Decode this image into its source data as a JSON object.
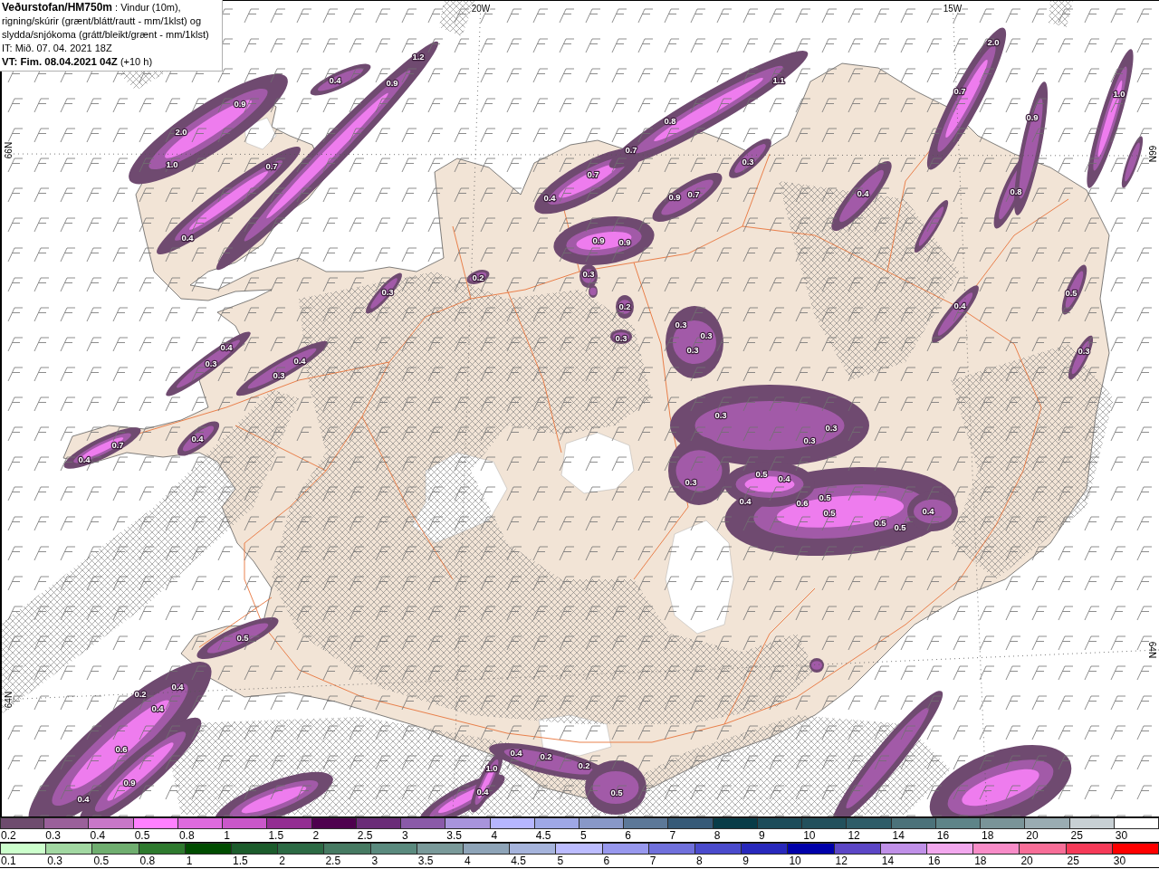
{
  "header": {
    "description": "**Veðurstofan/HM750m** : Vindur (10m), rigning/skúrir (grænt/blátt/rautt - mm/1klst) og slydda/snjókoma (grátt/bleikt/grænt - mm/1klst)",
    "issue_time": "IT: Mið. 07. 04. 2021 18Z",
    "valid_time": "**VT: Fim. 08.04.2021 04Z** (+10 h)"
  },
  "map": {
    "grid_labels": [
      {
        "kind": "top",
        "text": "20W"
      },
      {
        "kind": "top",
        "text": "15W"
      },
      {
        "kind": "left",
        "text": "66N"
      },
      {
        "kind": "right",
        "text": "66N"
      },
      {
        "kind": "right",
        "text": "64N"
      },
      {
        "kind": "left",
        "text": "64N"
      }
    ],
    "precipitation_values": [
      "2.0",
      "1.2",
      "0.4",
      "0.9",
      "1.1",
      "0.7",
      "1.0",
      "0.9",
      "0.8",
      "0.9",
      "2.0",
      "0.7",
      "1.0",
      "0.7",
      "0.3",
      "0.7",
      "0.4",
      "0.9",
      "0.7",
      "0.4",
      "0.8",
      "0.4",
      "0.9",
      "0.9",
      "0.2",
      "0.3",
      "0.3",
      "0.5",
      "0.2",
      "0.4",
      "0.3",
      "0.3",
      "0.3",
      "0.4",
      "0.3",
      "0.3",
      "0.3",
      "0.4",
      "0.3",
      "0.3",
      "0.3",
      "0.7",
      "0.4",
      "0.3",
      "0.4",
      "0.3",
      "0.5",
      "0.4",
      "0.4",
      "0.6",
      "0.5",
      "0.5",
      "0.4",
      "0.5",
      "0.5",
      "0.5",
      "0.2",
      "0.4",
      "0.4",
      "0.6",
      "0.4",
      "0.2",
      "1.0",
      "0.2",
      "0.9",
      "0.4",
      "0.4",
      "0.5"
    ]
  },
  "legend": {
    "snow_scale": [
      {
        "label": "0.2",
        "color": "#6e4c6e"
      },
      {
        "label": "0.3",
        "color": "#9a609a"
      },
      {
        "label": "0.4",
        "color": "#c877c8"
      },
      {
        "label": "0.5",
        "color": "#ff80ff"
      },
      {
        "label": "0.8",
        "color": "#de6ade"
      },
      {
        "label": "1",
        "color": "#c957c9"
      },
      {
        "label": "1.5",
        "color": "#932d92"
      },
      {
        "label": "2",
        "color": "#4e004e"
      },
      {
        "label": "2.5",
        "color": "#6a2c78"
      },
      {
        "label": "3",
        "color": "#8a5aa8"
      },
      {
        "label": "3.5",
        "color": "#a894dc"
      },
      {
        "label": "4",
        "color": "#b6b6ff"
      },
      {
        "label": "4.5",
        "color": "#9fa8e6"
      },
      {
        "label": "5",
        "color": "#8898c8"
      },
      {
        "label": "6",
        "color": "#5c7898"
      },
      {
        "label": "7",
        "color": "#365a78"
      },
      {
        "label": "8",
        "color": "#083c48"
      },
      {
        "label": "9",
        "color": "#1c4c5a"
      },
      {
        "label": "10",
        "color": "#22505c"
      },
      {
        "label": "12",
        "color": "#2e5c68"
      },
      {
        "label": "14",
        "color": "#4c727a"
      },
      {
        "label": "16",
        "color": "#5e8488"
      },
      {
        "label": "18",
        "color": "#7a9498"
      },
      {
        "label": "20",
        "color": "#9aacb2"
      },
      {
        "label": "25",
        "color": "#c8d0d4"
      },
      {
        "label": "30",
        "color": "#ffffff"
      }
    ],
    "rain_scale": [
      {
        "label": "0.1",
        "color": "#ccffcc"
      },
      {
        "label": "0.3",
        "color": "#a2d8a2"
      },
      {
        "label": "0.5",
        "color": "#6fae6f"
      },
      {
        "label": "0.8",
        "color": "#2e7a2e"
      },
      {
        "label": "1",
        "color": "#004c00"
      },
      {
        "label": "1.5",
        "color": "#1c5c2c"
      },
      {
        "label": "2",
        "color": "#2c6a44"
      },
      {
        "label": "2.5",
        "color": "#467a62"
      },
      {
        "label": "3",
        "color": "#5a8a7e"
      },
      {
        "label": "3.5",
        "color": "#7a9a9a"
      },
      {
        "label": "4",
        "color": "#8ea4b8"
      },
      {
        "label": "4.5",
        "color": "#a6b4dc"
      },
      {
        "label": "5",
        "color": "#bcbcff"
      },
      {
        "label": "6",
        "color": "#9898ee"
      },
      {
        "label": "7",
        "color": "#7070dc"
      },
      {
        "label": "8",
        "color": "#4a4acc"
      },
      {
        "label": "9",
        "color": "#2828bc"
      },
      {
        "label": "10",
        "color": "#0000aa"
      },
      {
        "label": "12",
        "color": "#5c46c6"
      },
      {
        "label": "14",
        "color": "#c090e8"
      },
      {
        "label": "16",
        "color": "#f2a8ee"
      },
      {
        "label": "18",
        "color": "#f88cc8"
      },
      {
        "label": "20",
        "color": "#f86e98"
      },
      {
        "label": "25",
        "color": "#f63a58"
      },
      {
        "label": "30",
        "color": "#ff0000"
      }
    ]
  }
}
